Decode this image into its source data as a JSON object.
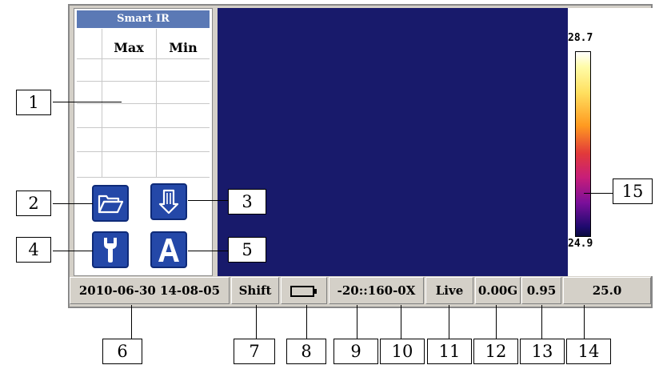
{
  "panel": {
    "title": "Smart IR",
    "headers": [
      "Max",
      "Min"
    ]
  },
  "status_bar": {
    "datetime": "2010-06-30 14-08-05",
    "shift": "Shift",
    "range": "-20::160-0X",
    "mode": "Live",
    "value_g": "0.00G",
    "emissivity": "0.95",
    "temperature": "25.0"
  },
  "scale": {
    "max": "28.7",
    "min": "24.9"
  },
  "callouts": [
    "1",
    "2",
    "3",
    "4",
    "5",
    "6",
    "7",
    "8",
    "9",
    "10",
    "11",
    "12",
    "13",
    "14",
    "15"
  ],
  "colors": {
    "thermal_background": "#181a6b",
    "panel_title": "#5b79b5",
    "icon_button": "#2448a8",
    "status_bar": "#d4d0c8"
  },
  "icons": [
    "folder-icon",
    "save-download-icon",
    "wrench-settings-icon",
    "auto-a-icon",
    "battery-icon"
  ]
}
